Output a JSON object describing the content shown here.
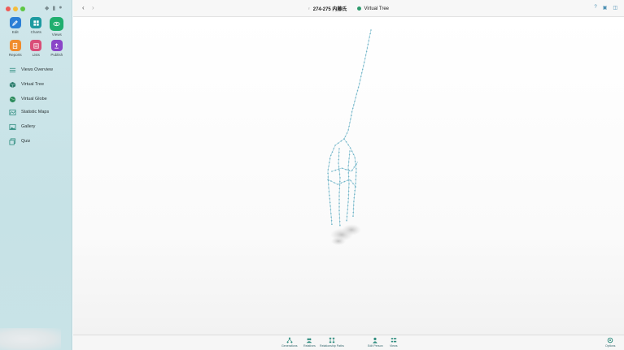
{
  "window": {
    "title": "274-275 内藤氏",
    "view_title": "Virtual Tree"
  },
  "colors": {
    "accent": "#2ca58d",
    "sidebar": "#c8e3e7",
    "active_nav": "#b3d3d8"
  },
  "apps": [
    {
      "label": "Edit",
      "icon": "pencil-icon",
      "color": "#2b7fd6"
    },
    {
      "label": "Charts",
      "icon": "charts-icon",
      "color": "#1d9aa0"
    },
    {
      "label": "Views",
      "icon": "eye-icon",
      "color": "#1fae6e",
      "selected": true
    },
    {
      "label": "Reports",
      "icon": "reports-icon",
      "color": "#f08c2c"
    },
    {
      "label": "Lists",
      "icon": "lists-icon",
      "color": "#d94d78"
    },
    {
      "label": "Publish",
      "icon": "publish-icon",
      "color": "#8a45c8"
    }
  ],
  "nav": [
    {
      "label": "Views Overview",
      "icon": "list-icon"
    },
    {
      "label": "Virtual Tree",
      "icon": "cube-icon",
      "active": true
    },
    {
      "label": "Virtual Globe",
      "icon": "globe-icon"
    },
    {
      "label": "Statistic Maps",
      "icon": "map-icon"
    },
    {
      "label": "Gallery",
      "icon": "gallery-icon"
    },
    {
      "label": "Quiz",
      "icon": "quiz-icon"
    }
  ],
  "bottom": [
    {
      "label": "Generations",
      "icon": "generations-icon"
    },
    {
      "label": "Relatives",
      "icon": "relatives-icon"
    },
    {
      "label": "Relationship Paths",
      "icon": "relationship-paths-icon"
    },
    {
      "label": "Edit Person",
      "icon": "person-icon"
    },
    {
      "label": "Views",
      "icon": "views-icon"
    },
    {
      "label": "Options",
      "icon": "gear-icon"
    }
  ]
}
